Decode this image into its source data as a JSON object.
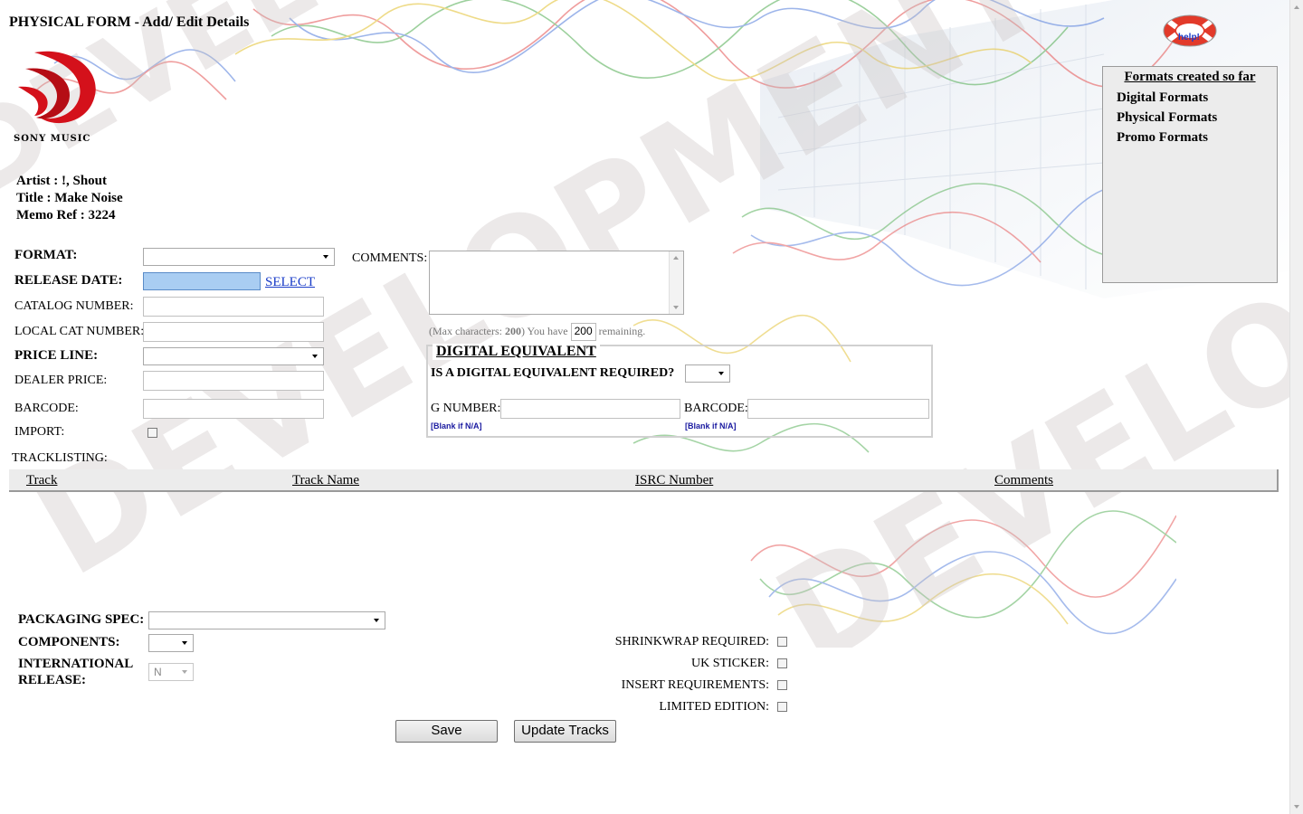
{
  "page": {
    "title": "PHYSICAL FORM - Add/ Edit Details",
    "watermark": "DEVELOPMENT",
    "logo_text": "SONY MUSIC",
    "help_label": "help!"
  },
  "info": {
    "artist": "Artist : !, Shout",
    "title": "Title : Make Noise",
    "memo": "Memo Ref : 3224"
  },
  "form": {
    "format_label": "FORMAT:",
    "release_date_label": "RELEASE DATE:",
    "select_link": "SELECT",
    "catalog_label": "CATALOG NUMBER:",
    "local_cat_label": "LOCAL CAT NUMBER:",
    "price_line_label": "PRICE LINE:",
    "dealer_price_label": "DEALER PRICE:",
    "barcode_label": "BARCODE:",
    "import_label": "IMPORT:",
    "comments_label": "COMMENTS:",
    "max_chars_prefix": "(Max characters:",
    "max_chars_value": "200",
    "max_chars_mid": ") You have",
    "remaining_value": "200",
    "remaining_suffix": "remaining."
  },
  "digital_equivalent": {
    "legend": "DIGITAL EQUIVALENT",
    "question": "IS A DIGITAL EQUIVALENT REQUIRED?",
    "g_number_label": "G NUMBER:",
    "barcode_label": "BARCODE:",
    "blank_note": "[Blank if N/A]"
  },
  "tracklisting": {
    "label": "TRACKLISTING:",
    "columns": [
      "Track",
      "Track Name",
      "ISRC Number",
      "Comments"
    ]
  },
  "packaging": {
    "packaging_spec_label": "PACKAGING SPEC:",
    "components_label": "COMPONENTS:",
    "international_label_1": "INTERNATIONAL",
    "international_label_2": "RELEASE:",
    "international_value": "N",
    "shrinkwrap_label": "SHRINKWRAP REQUIRED:",
    "uk_sticker_label": "UK STICKER:",
    "insert_label": "INSERT REQUIREMENTS:",
    "limited_label": "LIMITED EDITION:"
  },
  "buttons": {
    "save": "Save",
    "update_tracks": "Update Tracks"
  },
  "side_panel": {
    "header": "Formats created so far",
    "items": [
      "Digital Formats",
      "Physical Formats",
      "Promo Formats"
    ]
  },
  "colors": {
    "link": "#1a3cc8",
    "logo_red": "#d4111b",
    "highlight_input": "#a9cdf2",
    "panel_bg": "#ececec"
  }
}
